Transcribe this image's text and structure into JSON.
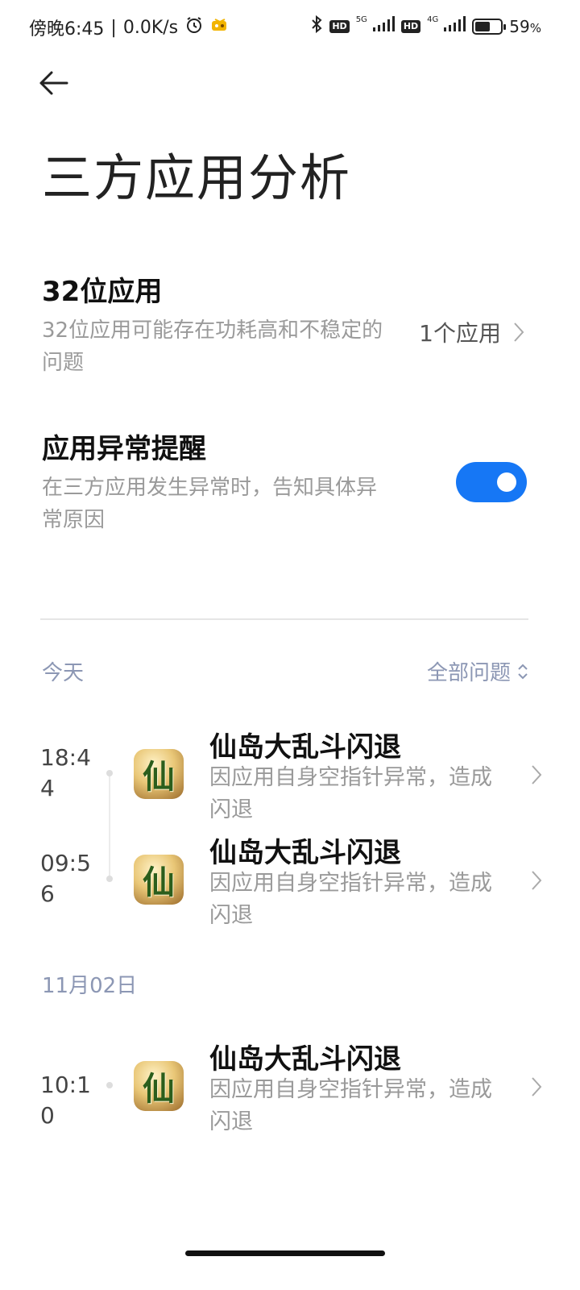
{
  "status_bar": {
    "time": "傍晚6:45",
    "separator": "|",
    "net_speed": "0.0K/s",
    "alarm_icon": "alarm-clock-icon",
    "notification_icon": "game-notification-icon",
    "bluetooth_icon": "bluetooth-icon",
    "sim1_hd": "HD",
    "sim1_network": "5G",
    "sim2_hd": "HD",
    "sim2_network": "4G",
    "battery_percent": "59",
    "battery_unit": "%",
    "battery_level": 0.59
  },
  "header": {
    "back_icon": "arrow-left-icon",
    "title": "三方应用分析"
  },
  "settings": {
    "bit32": {
      "title": "32位应用",
      "subtitle": "32位应用可能存在功耗高和不稳定的问题",
      "value": "1个应用"
    },
    "crash_alert": {
      "title": "应用异常提醒",
      "subtitle": "在三方应用发生异常时，告知具体异常原因",
      "enabled": true
    }
  },
  "filter": {
    "label": "全部问题",
    "icon": "chevron-up-down-icon"
  },
  "groups": [
    {
      "date": "今天",
      "entries": [
        {
          "time": "18:44",
          "title": "仙岛大乱斗闪退",
          "desc": "因应用自身空指针异常，造成闪退",
          "icon_char": "仙"
        },
        {
          "time": "09:56",
          "title": "仙岛大乱斗闪退",
          "desc": "因应用自身空指针异常，造成闪退",
          "icon_char": "仙"
        }
      ]
    },
    {
      "date": "11月02日",
      "entries": [
        {
          "time": "10:10",
          "title": "仙岛大乱斗闪退",
          "desc": "因应用自身空指针异常，造成闪退",
          "icon_char": "仙"
        }
      ]
    }
  ],
  "colors": {
    "accent": "#1677f5",
    "section_label": "#8c97b4",
    "secondary_text": "#9a9a9a"
  }
}
